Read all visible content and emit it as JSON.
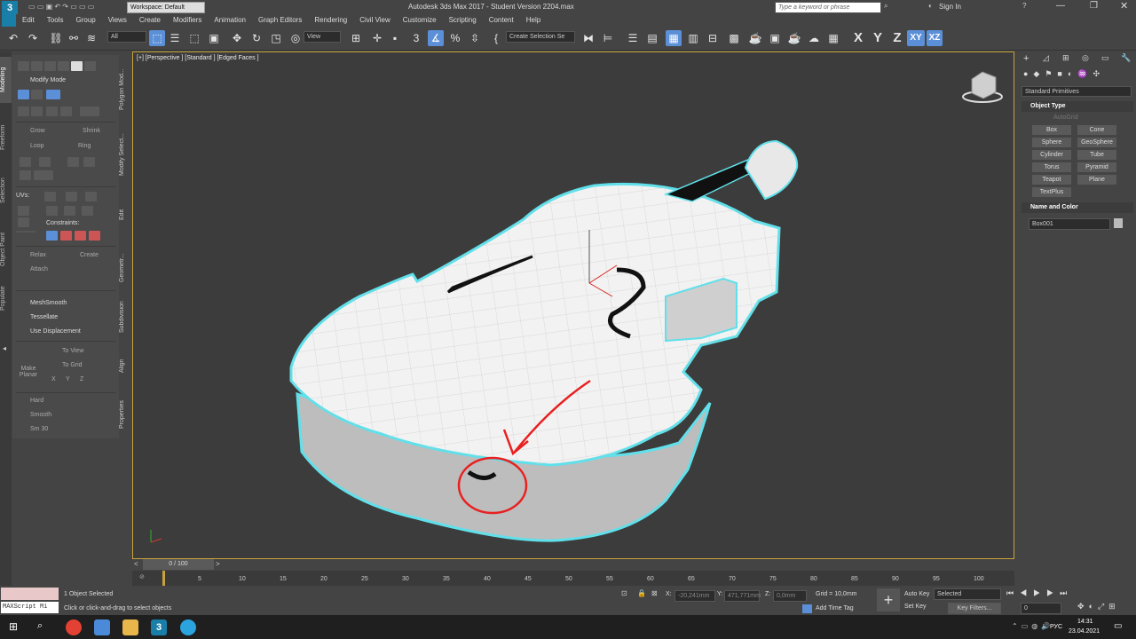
{
  "title": {
    "workspace": "Workspace: Default",
    "app_title": "Autodesk 3ds Max 2017 - Student Version    2204.max",
    "search_placeholder": "Type a keyword or phrase",
    "sign_in": "Sign In"
  },
  "menu": [
    "Edit",
    "Tools",
    "Group",
    "Views",
    "Create",
    "Modifiers",
    "Animation",
    "Graph Editors",
    "Rendering",
    "Civil View",
    "Customize",
    "Scripting",
    "Content",
    "Help"
  ],
  "toolbar": {
    "filter": "All",
    "ref_coord": "View",
    "selection_set": "Create Selection Se",
    "axes": [
      "X",
      "Y",
      "Z",
      "XY",
      "XZ"
    ]
  },
  "ribbon": {
    "tabs": [
      "Modeling",
      "Freeform",
      "Selection",
      "Object Paint",
      "Populate"
    ],
    "mode": "Modify Mode",
    "grow": "Grow",
    "shrink": "Shrink",
    "loop": "Loop",
    "ring": "Ring",
    "uvs": "UVs:",
    "constraints": "Constraints:",
    "relax": "Relax",
    "create": "Create",
    "attach": "Attach",
    "meshsmooth": "MeshSmooth",
    "tessellate": "Tessellate",
    "use_displacement": "Use Displacement",
    "make_planar": "Make Planar",
    "to_view": "To View",
    "to_grid": "To Grid",
    "xyz": [
      "X",
      "Y",
      "Z"
    ],
    "hard": "Hard",
    "smooth": "Smooth",
    "sm30": "Sm 30",
    "side_tabs": [
      "Polygon Mod...",
      "Modify Select...",
      "Edit",
      "Geometr...",
      "Subdivision",
      "Align",
      "Properties"
    ]
  },
  "viewport": {
    "label": "[+] [Perspective ] [Standard ] [Edged Faces ]"
  },
  "command_panel": {
    "dropdown": "Standard Primitives",
    "object_type": "Object Type",
    "autogrid": "AutoGrid",
    "buttons": [
      "Box",
      "Cone",
      "Sphere",
      "GeoSphere",
      "Cylinder",
      "Tube",
      "Torus",
      "Pyramid",
      "Teapot",
      "Plane",
      "TextPlus"
    ],
    "name_and_color": "Name and Color",
    "object_name": "Box001"
  },
  "time": {
    "slider": "0 / 100",
    "ticks": [
      "5",
      "10",
      "15",
      "20",
      "25",
      "30",
      "35",
      "40",
      "45",
      "50",
      "55",
      "60",
      "65",
      "70",
      "75",
      "80",
      "85",
      "90",
      "95",
      "100"
    ]
  },
  "status": {
    "maxscript": "MAXScript Mi",
    "selected": "1 Object Selected",
    "prompt": "Click or click-and-drag to select objects",
    "x": "-20,241mm",
    "y": "471,771mm",
    "z": "0,0mm",
    "grid": "Grid = 10,0mm",
    "add_time_tag": "Add Time Tag",
    "auto_key": "Auto Key",
    "set_key": "Set Key",
    "key_mode": "Selected",
    "key_filters": "Key Filters...",
    "frame": "0"
  },
  "taskbar": {
    "lang": "РУС",
    "time": "14:31",
    "date": "23.04.2021"
  }
}
